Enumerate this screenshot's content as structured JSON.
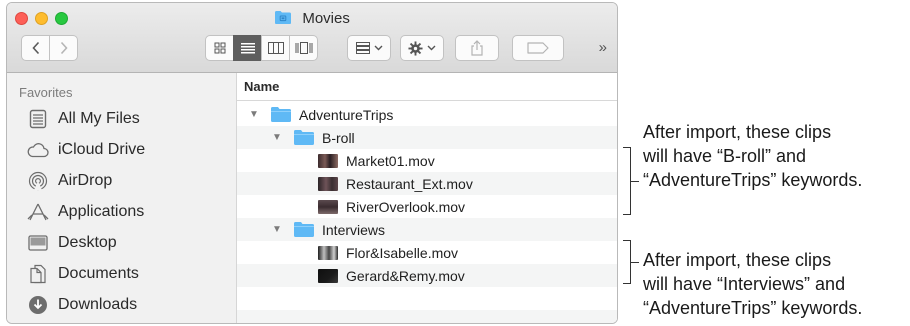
{
  "window": {
    "title": "Movies",
    "nav": {
      "back_icon": "chevron-left-icon",
      "forward_icon": "chevron-right-icon"
    },
    "view_modes": [
      "icon-view",
      "list-view",
      "column-view",
      "cover-flow-view"
    ],
    "active_view": "list-view",
    "toolbar_more": "»"
  },
  "sidebar": {
    "header": "Favorites",
    "items": [
      {
        "label": "All My Files",
        "icon": "all-files-icon"
      },
      {
        "label": "iCloud Drive",
        "icon": "cloud-icon"
      },
      {
        "label": "AirDrop",
        "icon": "airdrop-icon"
      },
      {
        "label": "Applications",
        "icon": "applications-icon"
      },
      {
        "label": "Desktop",
        "icon": "desktop-icon"
      },
      {
        "label": "Documents",
        "icon": "documents-icon"
      },
      {
        "label": "Downloads",
        "icon": "downloads-icon"
      }
    ]
  },
  "list": {
    "column_header": "Name",
    "rows": [
      {
        "label": "AdventureTrips",
        "kind": "folder",
        "depth": 0,
        "expanded": true
      },
      {
        "label": "B-roll",
        "kind": "folder",
        "depth": 1,
        "expanded": true
      },
      {
        "label": "Market01.mov",
        "kind": "clip",
        "depth": 2
      },
      {
        "label": "Restaurant_Ext.mov",
        "kind": "clip",
        "depth": 2
      },
      {
        "label": "RiverOverlook.mov",
        "kind": "clip",
        "depth": 2
      },
      {
        "label": "Interviews",
        "kind": "folder",
        "depth": 1,
        "expanded": true
      },
      {
        "label": "Flor&Isabelle.mov",
        "kind": "clip",
        "depth": 2
      },
      {
        "label": "Gerard&Remy.mov",
        "kind": "clip",
        "depth": 2
      }
    ]
  },
  "callouts": {
    "broll": [
      "After import, these clips",
      "will have “B-roll” and",
      "“AdventureTrips” keywords."
    ],
    "interviews": [
      "After import, these clips",
      "will have “Interviews” and",
      "“AdventureTrips” keywords."
    ]
  },
  "colors": {
    "folder_blue": "#5fb9f5",
    "selected_segment": "#5e5e5e",
    "close": "#fd5f57",
    "minimize": "#febc2e",
    "maximize": "#28c840"
  }
}
